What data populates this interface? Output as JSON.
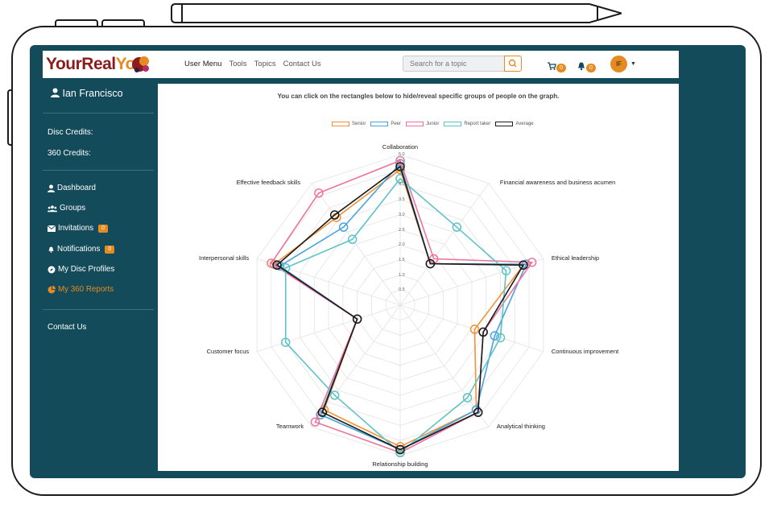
{
  "topbar": {
    "logo_part1": "YourReal",
    "logo_part2": "You",
    "menu": [
      "User Menu",
      "Tools",
      "Topics",
      "Contact Us"
    ],
    "search_placeholder": "Search for a topic",
    "cart_count": "0",
    "notification_count": "0",
    "avatar_initials": "IF"
  },
  "sidebar": {
    "user_name": "Ian Francisco",
    "disc_credits": "Disc Credits:",
    "credits_360": "360 Credits:",
    "items": [
      {
        "label": "Dashboard",
        "icon": "user-icon"
      },
      {
        "label": "Groups",
        "icon": "users-icon"
      },
      {
        "label": "Invitations",
        "icon": "envelope-icon",
        "badge": "0"
      },
      {
        "label": "Notifications",
        "icon": "bell-icon",
        "badge": "0"
      },
      {
        "label": "My Disc Profiles",
        "icon": "compass-icon"
      },
      {
        "label": "My 360 Reports",
        "icon": "pie-icon",
        "active": true
      }
    ],
    "contact": "Contact Us"
  },
  "main": {
    "note": "You can click on the rectangles below to hide/reveal specific groups of people on the graph."
  },
  "colors": {
    "accent": "#e58b22",
    "sidebar_bg": "#134b5a",
    "senior": "#f0923a",
    "peer": "#4aa3df",
    "junior": "#f0739a",
    "report_taker": "#5ec3c6",
    "average": "#1a1a1a"
  },
  "chart_data": {
    "type": "radar",
    "categories": [
      "Collaboration",
      "Financial awareness and business acumen",
      "Ethical leadership",
      "Continuous improvement",
      "Analytical thinking",
      "Relationship building",
      "Teamwork",
      "Customer focus",
      "Interpersonal skills",
      "Effective feedback skills"
    ],
    "ticks": [
      "0.5",
      "1.0",
      "1.5",
      "2.0",
      "2.5",
      "3.0",
      "3.5",
      "4.0",
      "4.5",
      "5.0"
    ],
    "rlim": [
      0,
      5
    ],
    "legend_position": "top",
    "series": [
      {
        "name": "Senior",
        "color": "#f0923a",
        "values": [
          4.5,
          1.7,
          4.3,
          2.6,
          4.3,
          4.7,
          4.3,
          1.5,
          4.4,
          3.6
        ]
      },
      {
        "name": "Peer",
        "color": "#4aa3df",
        "values": [
          4.7,
          1.7,
          4.4,
          3.3,
          4.3,
          4.8,
          4.5,
          1.5,
          4.2,
          3.2
        ]
      },
      {
        "name": "Junior",
        "color": "#f0739a",
        "values": [
          4.8,
          1.9,
          4.6,
          2.9,
          4.4,
          4.9,
          4.8,
          1.5,
          4.5,
          4.6
        ]
      },
      {
        "name": "Report taker",
        "color": "#5ec3c6",
        "values": [
          4.2,
          3.2,
          3.7,
          3.5,
          3.8,
          4.9,
          3.7,
          4.0,
          4.0,
          2.7
        ]
      },
      {
        "name": "Average",
        "color": "#1a1a1a",
        "values": [
          4.6,
          1.7,
          4.3,
          2.9,
          4.4,
          4.8,
          4.4,
          1.5,
          4.3,
          3.7
        ]
      }
    ]
  }
}
